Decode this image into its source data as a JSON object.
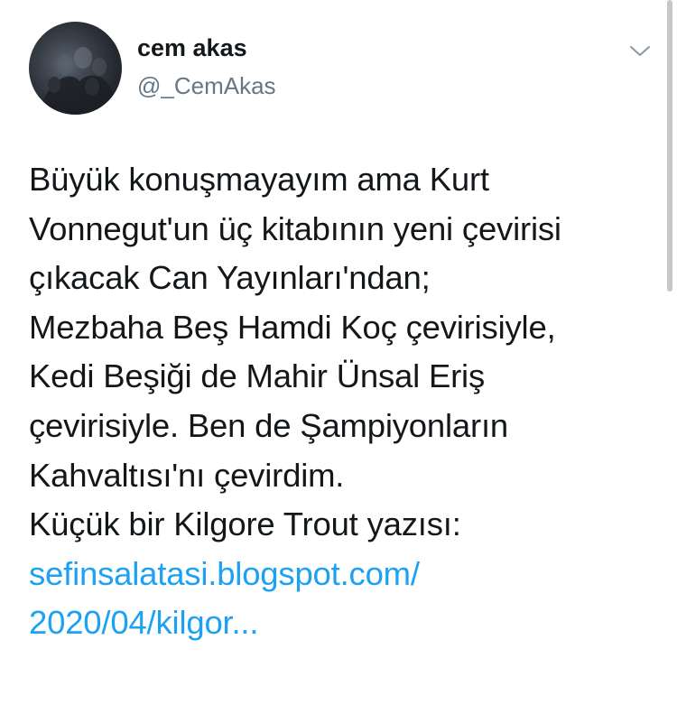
{
  "tweet": {
    "author": {
      "display_name": "cem akas",
      "handle": "@_CemAkas",
      "avatar_icon": "avatar-photo"
    },
    "menu_icon": "chevron-down-icon",
    "text_lines": [
      "Büyük konuşmayayım ama Kurt",
      "Vonnegut'un üç kitabının yeni çevirisi",
      "çıkacak Can Yayınları'ndan;",
      "Mezbaha Beş Hamdi Koç çevirisiyle,",
      "Kedi Beşiği de Mahir Ünsal Eriş",
      "çevirisiyle. Ben de Şampiyonların",
      "Kahvaltısı'nı çevirdim.",
      "Küçük bir Kilgore Trout yazısı:"
    ],
    "link_lines": [
      "sefinsalatasi.blogspot.com/",
      "2020/04/kilgor..."
    ],
    "colors": {
      "text": "#14171a",
      "secondary": "#657786",
      "link": "#1da1f2"
    }
  }
}
